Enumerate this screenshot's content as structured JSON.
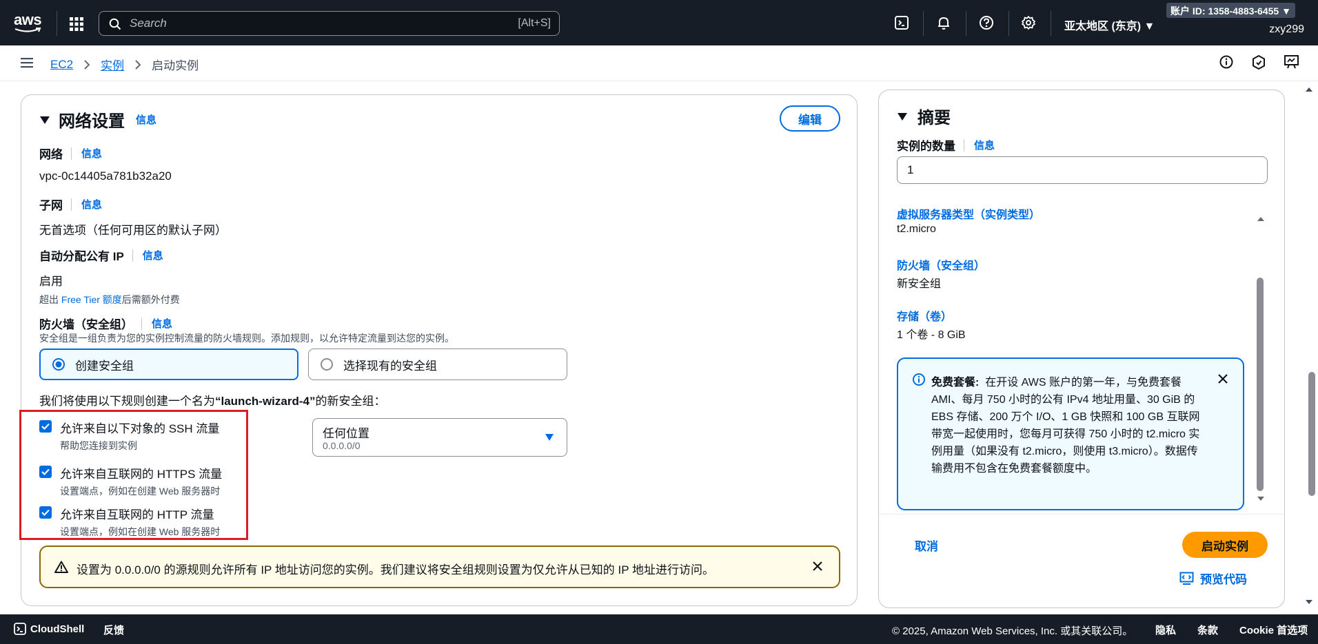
{
  "topnav": {
    "logo_text": "aws",
    "search_placeholder": "Search",
    "search_shortcut": "[Alt+S]",
    "region": "亚太地区 (东京) ▼",
    "account_badge": "账户 ID: 1358-4883-6455 ▼",
    "username": "zxy299"
  },
  "breadcrumb": {
    "items": [
      "EC2",
      "实例"
    ],
    "current": "启动实例"
  },
  "network": {
    "title": "网络设置",
    "info": "信息",
    "edit_button": "编辑",
    "network_label": "网络",
    "network_value": "vpc-0c14405a781b32a20",
    "subnet_label": "子网",
    "subnet_value": "无首选项（任何可用区的默认子网）",
    "auto_ip_label": "自动分配公有 IP",
    "auto_ip_value": "启用",
    "free_tier_note_pre": "超出 ",
    "free_tier_note_link": "Free Tier 额度",
    "free_tier_note_post": "后需额外付费",
    "firewall_label": "防火墙（安全组）",
    "firewall_desc": "安全组是一组负责为您的实例控制流量的防火墙规则。添加规则，以允许特定流量到达您的实例。",
    "radio_create": "创建安全组",
    "radio_existing": "选择现有的安全组",
    "intro_pre": "我们将使用以下规则创建一个名为",
    "intro_name": "“launch-wizard-4”",
    "intro_post": "的新安全组：",
    "rules": [
      {
        "title": "允许来自以下对象的 SSH 流量",
        "desc": "帮助您连接到实例",
        "checked": true
      },
      {
        "title": "允许来自互联网的 HTTPS 流量",
        "desc": "设置端点，例如在创建 Web 服务器时",
        "checked": true
      },
      {
        "title": "允许来自互联网的 HTTP 流量",
        "desc": "设置端点，例如在创建 Web 服务器时",
        "checked": true
      }
    ],
    "ssh_source_value": "任何位置",
    "ssh_source_cidr": "0.0.0.0/0",
    "warning": "设置为 0.0.0.0/0 的源规则允许所有 IP 地址访问您的实例。我们建议将安全组规则设置为仅允许从已知的 IP 地址进行访问。"
  },
  "summary": {
    "title": "摘要",
    "count_label": "实例的数量",
    "info": "信息",
    "count_value": "1",
    "instance_type_title": "虚拟服务器类型（实例类型）",
    "instance_type_value": "t2.micro",
    "firewall_title": "防火墙（安全组）",
    "firewall_value": "新安全组",
    "storage_title": "存储（卷）",
    "storage_value": "1 个卷 - 8 GiB",
    "free_tier_bold": "免费套餐:",
    "free_tier_text": "在开设 AWS 账户的第一年，与免费套餐 AMI、每月 750 小时的公有 IPv4 地址用量、30 GiB 的 EBS 存储、200 万个 I/O、1 GB 快照和 100 GB 互联网带宽一起使用时，您每月可获得 750 小时的 t2.micro 实例用量（如果没有 t2.micro，则使用 t3.micro）。数据传输费用不包含在免费套餐额度中。",
    "cancel": "取消",
    "launch": "启动实例",
    "preview_code": "预览代码"
  },
  "footer": {
    "cloudshell": "CloudShell",
    "feedback": "反馈",
    "copyright": "© 2025, Amazon Web Services, Inc. 或其关联公司。",
    "privacy": "隐私",
    "terms": "条款",
    "cookie": "Cookie 首选项"
  },
  "colors": {
    "nav_bg": "#161d26",
    "link": "#006ce0",
    "primary_button": "#ff9900",
    "highlight_box": "#e01b24",
    "warning_border": "#8d6605"
  }
}
